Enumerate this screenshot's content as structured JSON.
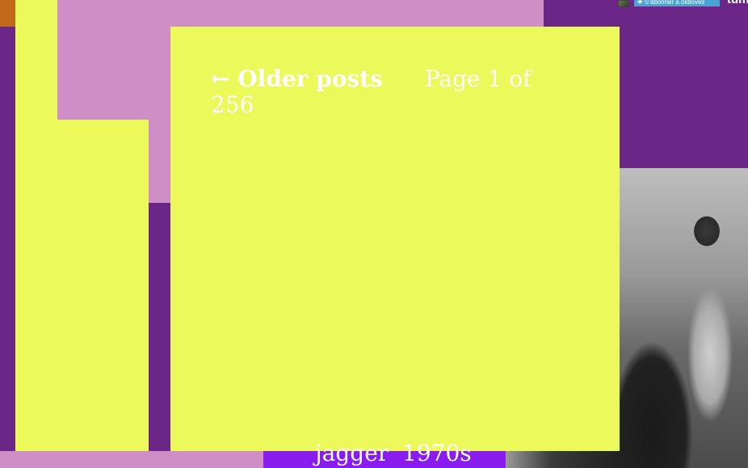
{
  "toolbar": {
    "follow_label": "✚ S'abonner à oldloves",
    "logo_text": "tumblr"
  },
  "pagination": {
    "older_label": "← Older posts",
    "page_text": "Page 1 of 256"
  },
  "tags": [
    {
      "label": "jagger"
    },
    {
      "label": "1970s"
    }
  ],
  "colors": {
    "background_purple": "#6b2688",
    "pink": "#d08ec6",
    "yellow": "#ecf95b",
    "orange": "#c26a1a",
    "tag_bar_purple": "#8a1cf0",
    "follow_button_blue": "#4aa3d6"
  },
  "icons": {
    "follow": "plus-icon"
  }
}
